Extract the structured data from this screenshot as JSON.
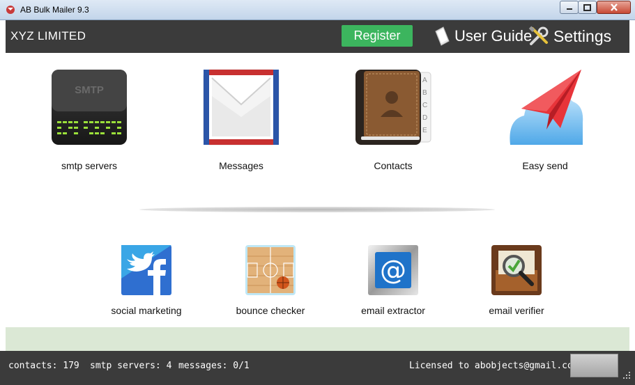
{
  "window": {
    "title": "AB Bulk Mailer 9.3",
    "minimize_icon": "minimize-icon",
    "maximize_icon": "maximize-icon",
    "close_icon": "close-icon"
  },
  "header": {
    "company": "XYZ LIMITED",
    "register_label": "Register",
    "user_guide_label": "User Guide",
    "settings_label": "Settings",
    "accent_color": "#3cb55e"
  },
  "main_tiles": [
    {
      "label": "smtp servers",
      "icon": "smtp-server-icon"
    },
    {
      "label": "Messages",
      "icon": "envelope-icon"
    },
    {
      "label": "Contacts",
      "icon": "address-book-icon"
    },
    {
      "label": "Easy send",
      "icon": "paper-plane-icon"
    }
  ],
  "tools": [
    {
      "label": "social marketing",
      "icon": "twitter-facebook-icon"
    },
    {
      "label": "bounce checker",
      "icon": "basketball-court-icon"
    },
    {
      "label": "email extractor",
      "icon": "at-sign-icon"
    },
    {
      "label": "email verifier",
      "icon": "magnifier-check-icon"
    }
  ],
  "smtp_badge": "SMTP",
  "status": {
    "contacts": "contacts: 179",
    "smtp_servers": "smtp servers: 4",
    "messages": "messages: 0/1",
    "license": "Licensed to abobjects@gmail.com"
  }
}
